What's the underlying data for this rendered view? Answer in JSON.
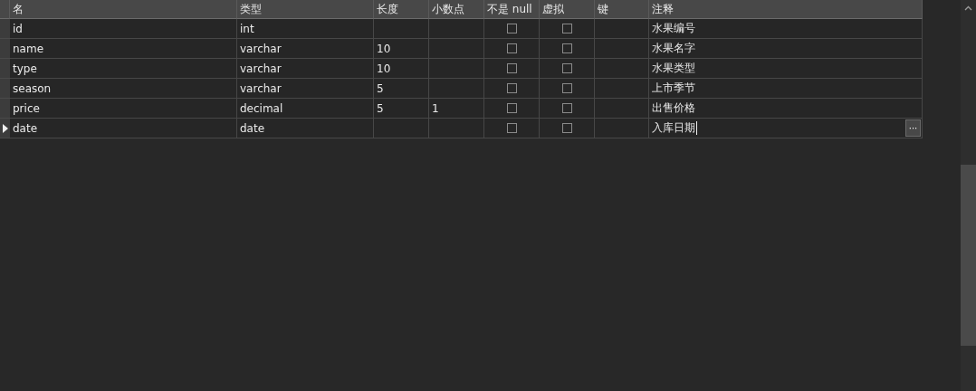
{
  "table": {
    "columns": [
      "名",
      "类型",
      "长度",
      "小数点",
      "不是 null",
      "虚拟",
      "键",
      "注释"
    ],
    "rows": [
      {
        "selected": false,
        "name": "id",
        "type": "int",
        "length": "",
        "decimals": "",
        "not_null": false,
        "virtual": false,
        "comment": "水果编号"
      },
      {
        "selected": false,
        "name": "name",
        "type": "varchar",
        "length": "10",
        "decimals": "",
        "not_null": false,
        "virtual": false,
        "comment": "水果名字"
      },
      {
        "selected": false,
        "name": "type",
        "type": "varchar",
        "length": "10",
        "decimals": "",
        "not_null": false,
        "virtual": false,
        "comment": "水果类型"
      },
      {
        "selected": false,
        "name": "season",
        "type": "varchar",
        "length": "5",
        "decimals": "",
        "not_null": false,
        "virtual": false,
        "comment": "上市季节"
      },
      {
        "selected": false,
        "name": "price",
        "type": "decimal",
        "length": "5",
        "decimals": "1",
        "not_null": false,
        "virtual": false,
        "comment": "出售价格"
      },
      {
        "selected": true,
        "name": "date",
        "type": "date",
        "length": "",
        "decimals": "",
        "not_null": false,
        "virtual": false,
        "comment": "入库日期"
      }
    ],
    "more_button": "···"
  }
}
